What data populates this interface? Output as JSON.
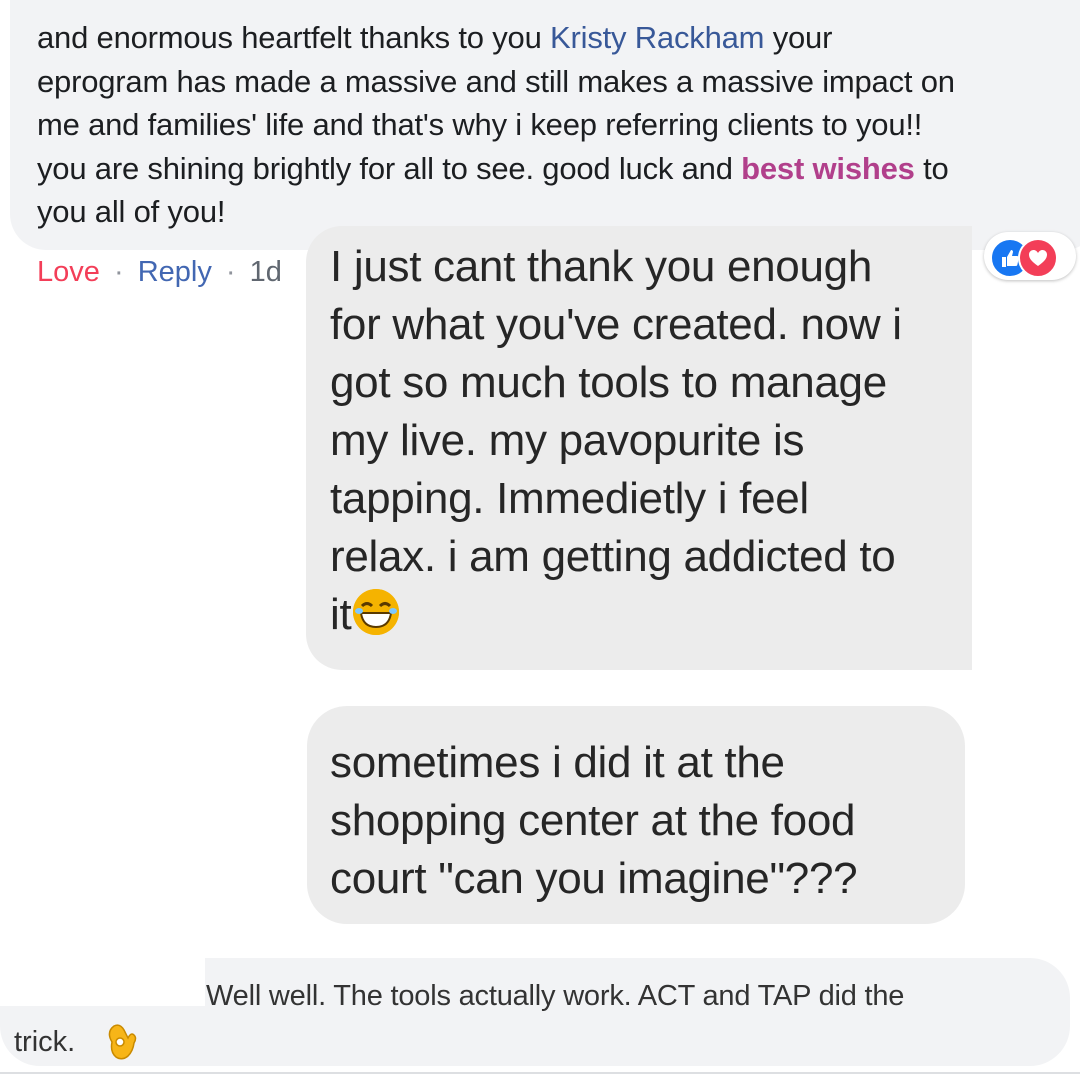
{
  "top_comment": {
    "line1_prefix": "and enormous heartfelt thanks to you ",
    "mention": "Kristy Rackham",
    "line1_suffix": " your",
    "line2": "eprogram has made a massive and still makes a massive impact on",
    "line3": "me and families' life and that's why i keep referring clients to you!!",
    "line4_prefix": "you are shining brightly for all to see. good luck and ",
    "highlight": "best wishes",
    "line4_suffix": " to",
    "line5": "you all of you!"
  },
  "actions": {
    "love": "Love",
    "separator": "·",
    "reply": "Reply",
    "time": "1d"
  },
  "reactions": [
    "like-icon",
    "love-icon"
  ],
  "message1": {
    "text": "I just cant thank you enough\nfor what you've created. now i\ngot so much tools to manage\nmy live. my pavopurite is\ntapping. Immedietly i feel\nrelax. i am getting addicted to\nit",
    "emoji": "laughing-emoji"
  },
  "message2": {
    "text": "sometimes i did it at the shopping center at the food court \"can you imagine\"???"
  },
  "bottom_comment": {
    "line1": "Well well. The tools actually work. ACT and TAP did the",
    "line2": "trick.",
    "emoji": "ok-hand-emoji"
  },
  "colors": {
    "mention": "#385898",
    "highlight": "#b13f8b",
    "love": "#f33e58",
    "reply": "#4267b2",
    "bubble": "#f2f3f5",
    "chat_bubble": "#ececec"
  }
}
